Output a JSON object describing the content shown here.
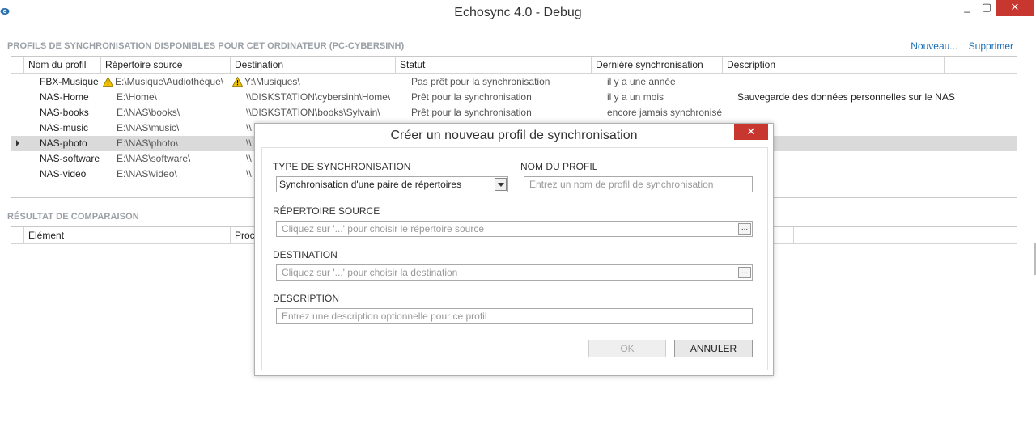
{
  "window": {
    "title": "Echosync 4.0 - Debug",
    "min_label": "_",
    "max_label": "▢",
    "close_label": "✕"
  },
  "profiles": {
    "section_title": "PROFILS DE SYNCHRONISATION DISPONIBLES POUR CET ORDINATEUR (PC-CYBERSINH)",
    "new_link": "Nouveau...",
    "delete_link": "Supprimer",
    "columns": [
      "Nom du profil",
      "Répertoire source",
      "Destination",
      "Statut",
      "Dernière synchronisation",
      "Description"
    ],
    "rows": [
      {
        "name": "FBX-Musique",
        "source": "E:\\Musique\\Audiothèque\\",
        "destination": "Y:\\Musiques\\",
        "status": "Pas prêt pour la synchronisation",
        "last_sync": "il y a une année",
        "description": "",
        "warn_source": true,
        "warn_dest": true
      },
      {
        "name": "NAS-Home",
        "source": "E:\\Home\\",
        "destination": "\\\\DISKSTATION\\cybersinh\\Home\\",
        "status": "Prêt pour la synchronisation",
        "last_sync": "il y a un mois",
        "description": "Sauvegarde des données personnelles sur le NAS"
      },
      {
        "name": "NAS-books",
        "source": "E:\\NAS\\books\\",
        "destination": "\\\\DISKSTATION\\books\\Sylvain\\",
        "status": "Prêt pour la synchronisation",
        "last_sync": "encore jamais synchronisé",
        "description": ""
      },
      {
        "name": "NAS-music",
        "source": "E:\\NAS\\music\\",
        "destination": "\\\\",
        "status": "",
        "last_sync": "",
        "description": ""
      },
      {
        "name": "NAS-photo",
        "source": "E:\\NAS\\photo\\",
        "destination": "\\\\",
        "status": "",
        "last_sync": "",
        "description": "",
        "selected": true
      },
      {
        "name": "NAS-software",
        "source": "E:\\NAS\\software\\",
        "destination": "\\\\",
        "status": "",
        "last_sync": "",
        "description": ""
      },
      {
        "name": "NAS-video",
        "source": "E:\\NAS\\video\\",
        "destination": "\\\\",
        "status": "",
        "last_sync": "",
        "description": ""
      }
    ]
  },
  "comparison": {
    "section_title": "RÉSULTAT DE COMPARAISON",
    "columns": [
      "Elément",
      "Proce"
    ]
  },
  "dialog": {
    "title": "Créer un nouveau profil de synchronisation",
    "close_label": "✕",
    "sync_type_label": "TYPE DE SYNCHRONISATION",
    "sync_type_value": "Synchronisation d'une paire de répertoires",
    "profile_name_label": "NOM DU PROFIL",
    "profile_name_placeholder": "Entrez un nom de profil de synchronisation",
    "source_label": "RÉPERTOIRE SOURCE",
    "source_placeholder": "Cliquez sur '...' pour choisir le répertoire source",
    "destination_label": "DESTINATION",
    "destination_placeholder": "Cliquez sur '...' pour choisir la destination",
    "description_label": "DESCRIPTION",
    "description_placeholder": "Entrez une description optionnelle pour ce profil",
    "browse_label": "...",
    "ok_label": "OK",
    "cancel_label": "ANNULER"
  }
}
